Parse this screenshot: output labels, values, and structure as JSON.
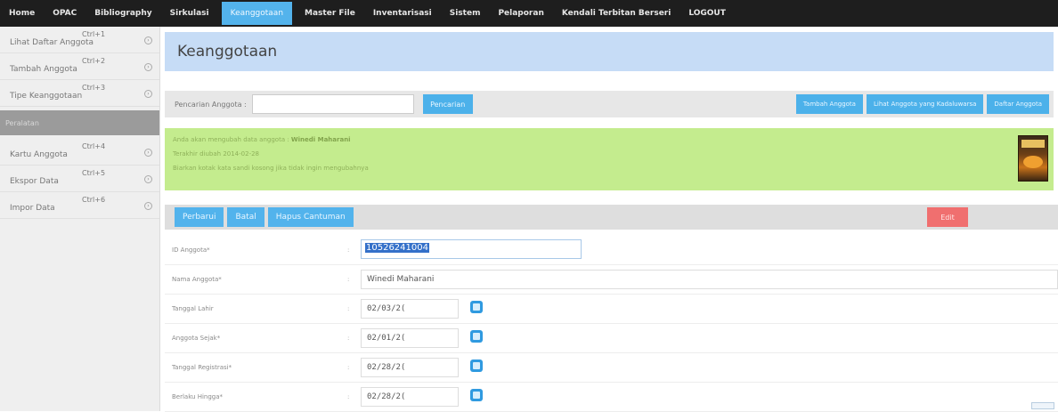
{
  "nav": {
    "tabs": [
      {
        "label": "Home"
      },
      {
        "label": "OPAC"
      },
      {
        "label": "Bibliography"
      },
      {
        "label": "Sirkulasi"
      },
      {
        "label": "Keanggotaan"
      },
      {
        "label": "Master File"
      },
      {
        "label": "Inventarisasi"
      },
      {
        "label": "Sistem"
      },
      {
        "label": "Pelaporan"
      },
      {
        "label": "Kendali Terbitan Berseri"
      },
      {
        "label": "LOGOUT"
      }
    ],
    "active_index": 4,
    "active_color": "#53b3ec"
  },
  "sidebar": {
    "items": [
      {
        "label": "Lihat Daftar Anggota",
        "shortcut": "Ctrl+1"
      },
      {
        "label": "Tambah Anggota",
        "shortcut": "Ctrl+2"
      },
      {
        "label": "Tipe Keanggotaan",
        "shortcut": "Ctrl+3"
      }
    ],
    "section": "Peralatan",
    "tools": [
      {
        "label": "Kartu Anggota",
        "shortcut": "Ctrl+4"
      },
      {
        "label": "Ekspor Data",
        "shortcut": "Ctrl+5"
      },
      {
        "label": "Impor Data",
        "shortcut": "Ctrl+6"
      }
    ]
  },
  "main": {
    "title": "Keanggotaan",
    "search": {
      "label": "Pencarian Anggota :",
      "value": "",
      "button": "Pencarian"
    },
    "top_buttons": [
      "Tambah Anggota",
      "Lihat Anggota yang Kadaluwarsa",
      "Daftar Anggota"
    ],
    "notice": {
      "line1_prefix": "Anda akan mengubah data anggota : ",
      "member_name": "Winedi Maharani",
      "line2": "Terakhir diubah 2014-02-28",
      "line3": "Biarkan kotak kata sandi kosong jika tidak ingin mengubahnya",
      "notice_color": "#c4ec8e"
    },
    "actions": {
      "update": "Perbarui",
      "cancel": "Batal",
      "delete": "Hapus Cantuman",
      "edit": "Edit"
    },
    "form": {
      "member_id": {
        "label": "ID Anggota*",
        "value": "10526241004"
      },
      "member_name": {
        "label": "Nama Anggota*",
        "value": "Winedi Maharani"
      },
      "birth_date": {
        "label": "Tanggal Lahir",
        "value": "02/03/2("
      },
      "member_since": {
        "label": "Anggota Sejak*",
        "value": "02/01/2("
      },
      "register_date": {
        "label": "Tanggal Registrasi*",
        "value": "02/28/2("
      },
      "expiry_date": {
        "label": "Berlaku Hingga*",
        "value": "02/28/2("
      }
    }
  }
}
